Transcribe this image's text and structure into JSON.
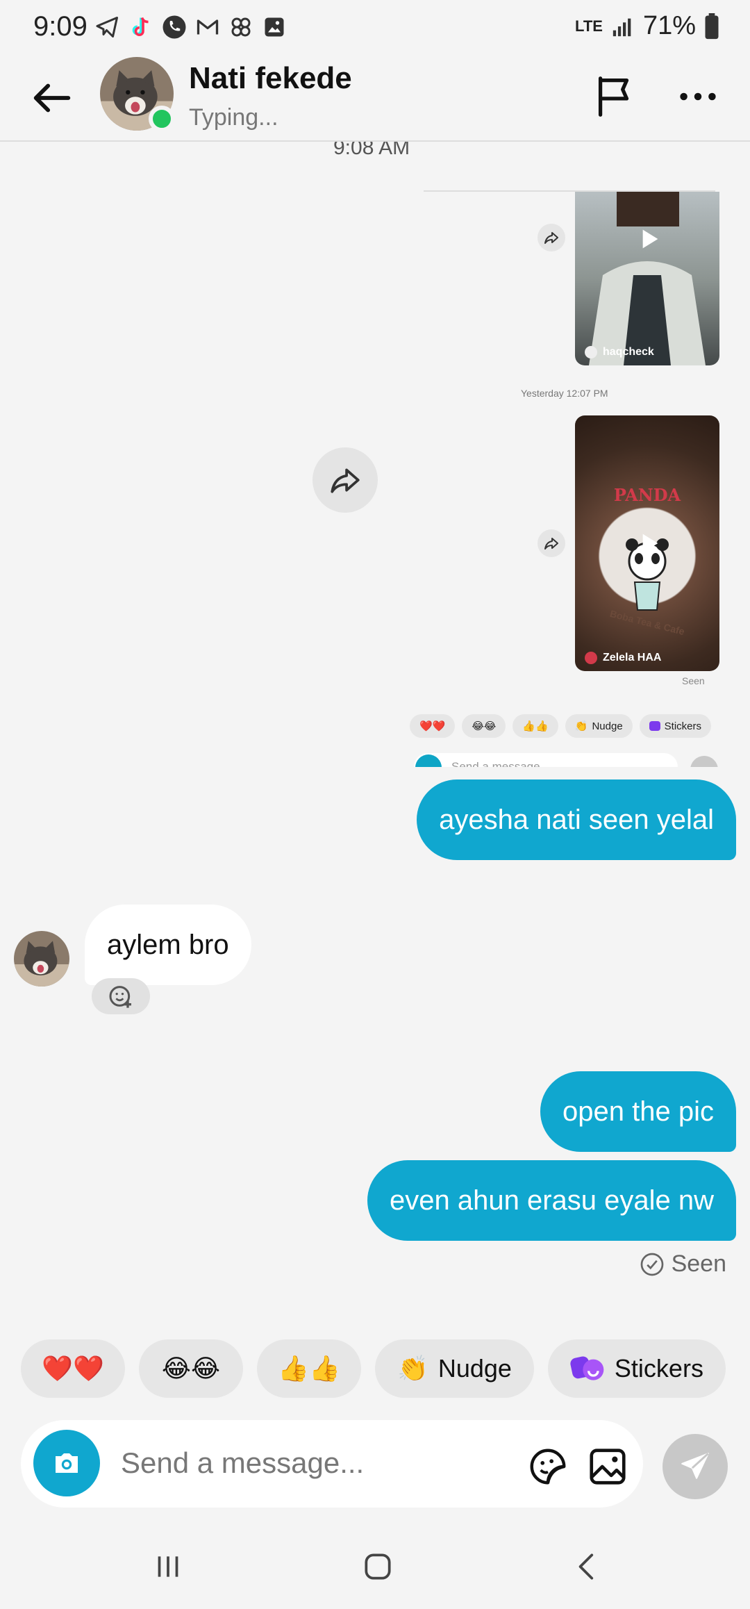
{
  "status_bar": {
    "time": "9:09",
    "network": "LTE",
    "battery": "71%",
    "notification_icons": [
      "telegram-icon",
      "tiktok-icon",
      "phone-icon",
      "gmail-icon",
      "pinwheel-icon",
      "gallery-icon"
    ]
  },
  "header": {
    "contact_name": "Nati fekede",
    "status": "Typing...",
    "online": true
  },
  "embedded_screenshot": {
    "top_time": "9:08 AM",
    "video_1_user": "haqcheck",
    "timestamp": "Yesterday 12:07 PM",
    "video_2_user": "Zelela HAA",
    "video_2_caption_lines": [
      "PANDA",
      "Boba Tea & Cafe"
    ],
    "seen": "Seen",
    "chips": [
      "❤️❤️",
      "😂😂",
      "👍👍",
      "Nudge",
      "Stickers"
    ],
    "input_placeholder": "Send a message"
  },
  "messages": [
    {
      "direction": "out",
      "text": "ayesha nati seen yelal"
    },
    {
      "direction": "in",
      "text": "aylem bro"
    },
    {
      "direction": "out",
      "text": "open the pic"
    },
    {
      "direction": "out",
      "text": "even ahun erasu eyale nw"
    }
  ],
  "seen_label": "Seen",
  "quick_replies": [
    {
      "label": "❤️❤️"
    },
    {
      "label": "😂😂"
    },
    {
      "label": "👍👍"
    },
    {
      "emoji": "👏",
      "label": "Nudge"
    },
    {
      "label": "Stickers"
    }
  ],
  "composer": {
    "placeholder": "Send a message..."
  },
  "colors": {
    "outgoing_bubble": "#10a7cf",
    "online_dot": "#22c55e",
    "background": "#f4f4f4"
  }
}
